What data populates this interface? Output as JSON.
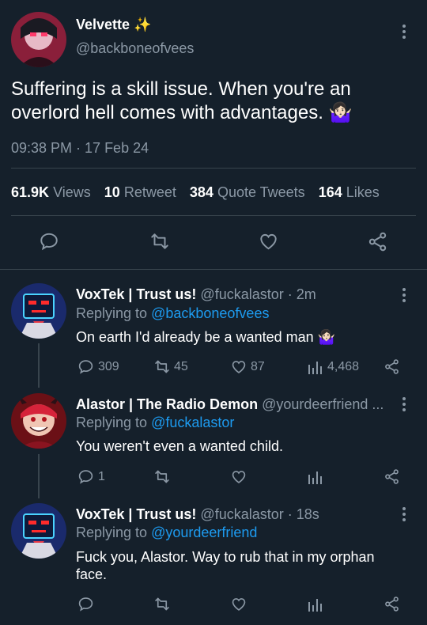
{
  "main_tweet": {
    "display_name": "Velvette",
    "name_emoji": "✨",
    "handle": "@backboneofvees",
    "text_line1": "Suffering is a skill issue. When you're an",
    "text_line2": "overlord hell comes with advantages.",
    "text_emoji": "🤷🏻‍♀️",
    "timestamp": "09:38 PM · 17 Feb 24",
    "stats": {
      "views_count": "61.9K",
      "views_label": "Views",
      "retweet_count": "10",
      "retweet_label": "Retweet",
      "quote_count": "384",
      "quote_label": "Quote Tweets",
      "likes_count": "164",
      "likes_label": "Likes"
    }
  },
  "replies": [
    {
      "display_name": "VoxTek | Trust us!",
      "handle": "@fuckalastor",
      "time": "· 2m",
      "replying_prefix": "Replying to",
      "replying_to": "@backboneofvees",
      "text": "On earth I'd already be a wanted man",
      "text_emoji": "🤷🏻‍♀️",
      "reply_count": "309",
      "retweet_count": "45",
      "like_count": "87",
      "view_count": "4,468"
    },
    {
      "display_name": "Alastor | The Radio Demon",
      "handle": "@yourdeerfriend ...",
      "replying_prefix": "Replying to",
      "replying_to": "@fuckalastor",
      "text": "You weren't even a wanted child.",
      "reply_count": "1"
    },
    {
      "display_name": "VoxTek | Trust us!",
      "handle": "@fuckalastor",
      "time": "· 18s",
      "replying_prefix": "Replying to",
      "replying_to": "@yourdeerfriend",
      "text_line1": "Fuck you, Alastor. Way to rub that in my orphan",
      "text_line2": "face."
    }
  ],
  "colors": {
    "background": "#15202b",
    "text": "#ffffff",
    "muted": "#8b98a5",
    "link": "#1d9bf0",
    "divider": "#38444d"
  },
  "icons": [
    "more-icon",
    "reply-icon",
    "retweet-icon",
    "like-icon",
    "share-icon",
    "views-icon"
  ]
}
